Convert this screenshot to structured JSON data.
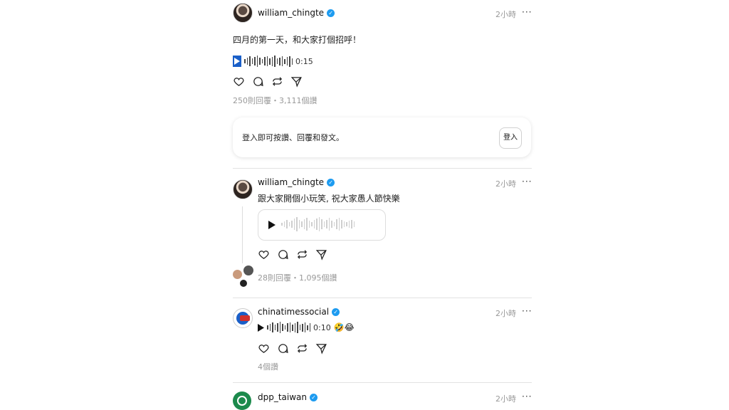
{
  "colors": {
    "verified": "#1d9bf0",
    "meta": "#999999",
    "play_accent": "#1a5fc8"
  },
  "posts": [
    {
      "username": "william_chingte",
      "time": "2小時",
      "more": "···",
      "text": "四月的第一天，和大家打個招呼！",
      "audio_duration": "0:15",
      "stats": "250則回覆・3,111個讚"
    },
    {
      "username": "william_chingte",
      "time": "2小時",
      "more": "···",
      "text": "跟大家開個小玩笑, 祝大家愚人節快樂",
      "stats": "28則回覆・1,095個讚"
    },
    {
      "username": "chinatimessocial",
      "time": "2小時",
      "more": "···",
      "audio_duration": "0:10",
      "emoji": "🤣😂",
      "stats": "4個讚"
    },
    {
      "username": "dpp_taiwan",
      "time": "2小時",
      "more": "···"
    }
  ],
  "login_card": {
    "text": "登入即可按讚、回覆和發文。",
    "button": "登入"
  },
  "icons": [
    "heart-icon",
    "comment-icon",
    "repost-icon",
    "share-icon",
    "verified-icon",
    "play-icon"
  ]
}
